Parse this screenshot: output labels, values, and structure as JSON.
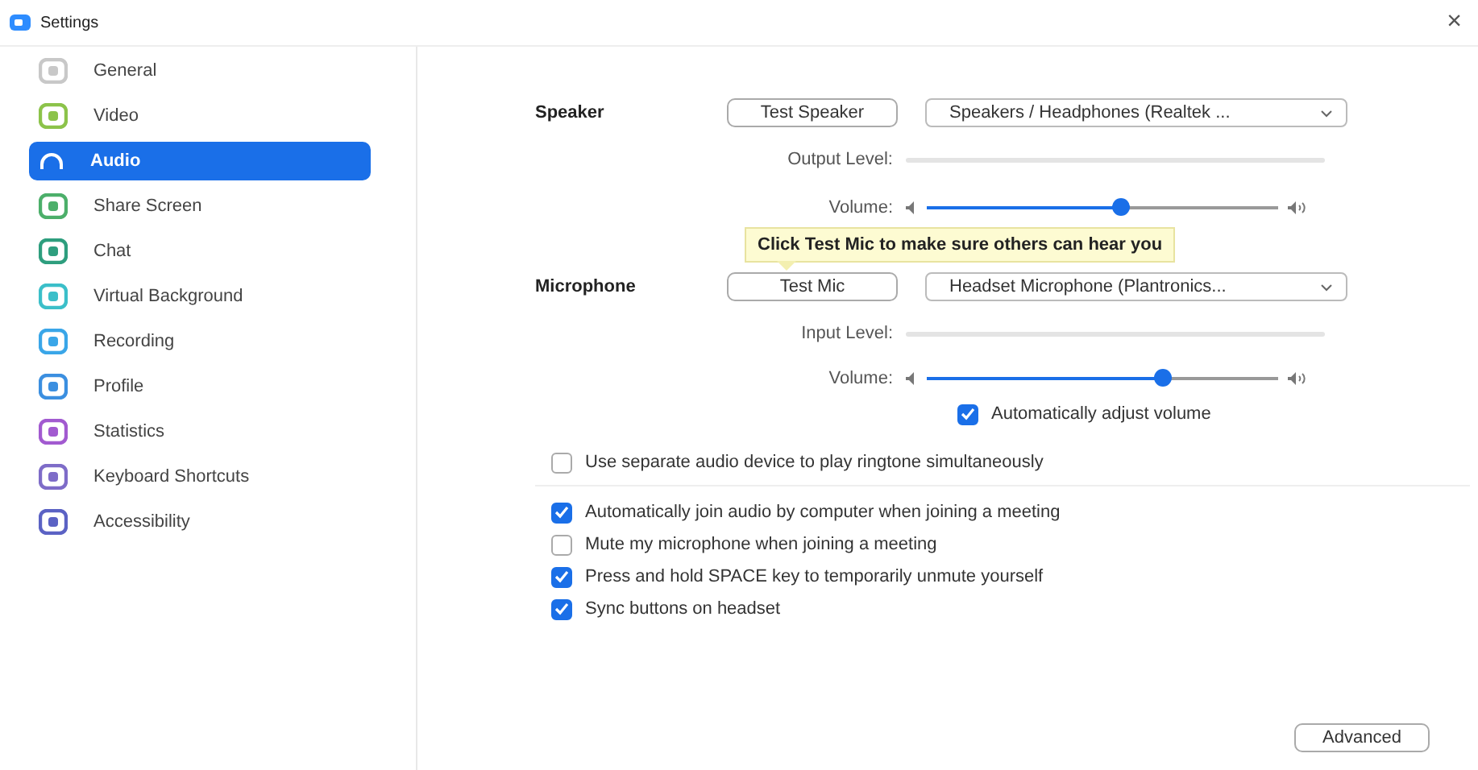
{
  "window": {
    "title": "Settings",
    "close": "×"
  },
  "sidebar": {
    "items": [
      {
        "label": "General",
        "color": "#c8c8c8",
        "selected": false
      },
      {
        "label": "Video",
        "color": "#8cc34a",
        "selected": false
      },
      {
        "label": "Audio",
        "color": "#ffffff",
        "selected": true
      },
      {
        "label": "Share Screen",
        "color": "#4caf6a",
        "selected": false
      },
      {
        "label": "Chat",
        "color": "#2e9e7e",
        "selected": false
      },
      {
        "label": "Virtual Background",
        "color": "#3bbfc9",
        "selected": false
      },
      {
        "label": "Recording",
        "color": "#3aa6e8",
        "selected": false
      },
      {
        "label": "Profile",
        "color": "#3b8fe0",
        "selected": false
      },
      {
        "label": "Statistics",
        "color": "#a25ad0",
        "selected": false
      },
      {
        "label": "Keyboard Shortcuts",
        "color": "#7e6cc8",
        "selected": false
      },
      {
        "label": "Accessibility",
        "color": "#5b62c4",
        "selected": false
      }
    ]
  },
  "speaker": {
    "label": "Speaker",
    "test_button": "Test Speaker",
    "device": "Speakers / Headphones (Realtek ...",
    "level_label": "Output Level:",
    "volume_label": "Volume:",
    "volume": {
      "level": 0.55
    }
  },
  "tooltip": "Click Test Mic to make sure others can hear you",
  "microphone": {
    "label": "Microphone",
    "test_button": "Test Mic",
    "device": "Headset Microphone (Plantronics...",
    "level_label": "Input Level:",
    "volume_label": "Volume:",
    "volume": {
      "level": 0.67
    },
    "auto_adjust": {
      "label": "Automatically adjust volume",
      "checked": true
    }
  },
  "ringtone": {
    "label": "Use separate audio device to play ringtone simultaneously",
    "checked": false
  },
  "options": [
    {
      "label": "Automatically join audio by computer when joining a meeting",
      "checked": true
    },
    {
      "label": "Mute my microphone when joining a meeting",
      "checked": false
    },
    {
      "label": "Press and hold SPACE key to temporarily unmute yourself",
      "checked": true
    },
    {
      "label": "Sync buttons on headset",
      "checked": true
    }
  ],
  "advanced_button": "Advanced"
}
